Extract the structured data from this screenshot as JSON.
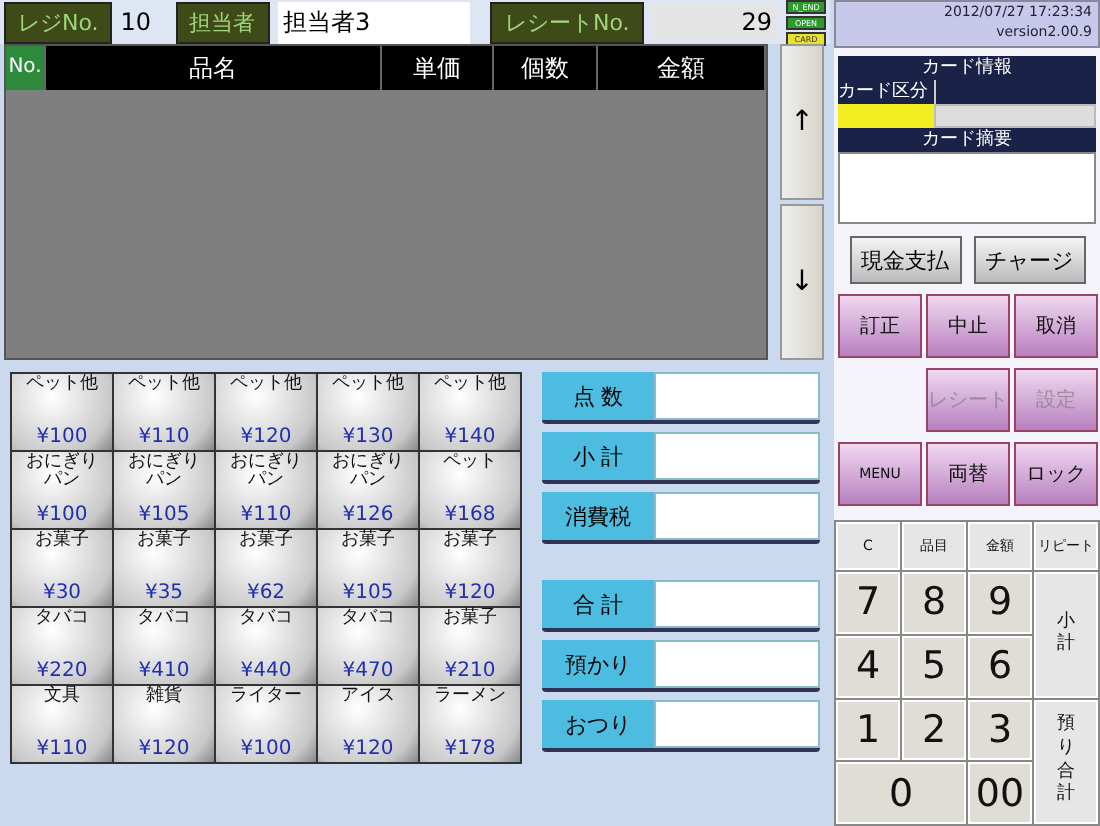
{
  "header": {
    "register_label": "レジNo.",
    "register_no": "10",
    "staff_label": "担当者",
    "staff_name": "担当者3",
    "receipt_label": "レシートNo.",
    "receipt_no": "29",
    "indicators": [
      {
        "label": "N_END",
        "color": "#2e9a2e"
      },
      {
        "label": "OPEN",
        "color": "#2e9a2e"
      },
      {
        "label": "CARD",
        "color": "#e8e030"
      }
    ]
  },
  "table": {
    "columns": [
      "No.",
      "品名",
      "単価",
      "個数",
      "金額"
    ]
  },
  "scroll_buttons": [
    "↑",
    "↓"
  ],
  "products": [
    {
      "name": "ペット他",
      "price": "¥100"
    },
    {
      "name": "ペット他",
      "price": "¥110"
    },
    {
      "name": "ペット他",
      "price": "¥120"
    },
    {
      "name": "ペット他",
      "price": "¥130"
    },
    {
      "name": "ペット他",
      "price": "¥140"
    },
    {
      "name": "おにぎりパン",
      "price": "¥100"
    },
    {
      "name": "おにぎりパン",
      "price": "¥105"
    },
    {
      "name": "おにぎりパン",
      "price": "¥110"
    },
    {
      "name": "おにぎりパン",
      "price": "¥126"
    },
    {
      "name": "ペット",
      "price": "¥168"
    },
    {
      "name": "お菓子",
      "price": "¥30"
    },
    {
      "name": "お菓子",
      "price": "¥35"
    },
    {
      "name": "お菓子",
      "price": "¥62"
    },
    {
      "name": "お菓子",
      "price": "¥105"
    },
    {
      "name": "お菓子",
      "price": "¥120"
    },
    {
      "name": "タバコ",
      "price": "¥220"
    },
    {
      "name": "タバコ",
      "price": "¥410"
    },
    {
      "name": "タバコ",
      "price": "¥440"
    },
    {
      "name": "タバコ",
      "price": "¥470"
    },
    {
      "name": "お菓子",
      "price": "¥210"
    },
    {
      "name": "文具",
      "price": "¥110"
    },
    {
      "name": "雑貨",
      "price": "¥120"
    },
    {
      "name": "ライター",
      "price": "¥100"
    },
    {
      "name": "アイス",
      "price": "¥120"
    },
    {
      "name": "ラーメン",
      "price": "¥178"
    }
  ],
  "totals_upper": [
    "点 数",
    "小 計",
    "消費税"
  ],
  "totals_lower": [
    "合 計",
    "預かり",
    "おつり"
  ],
  "info": {
    "datetime": "2012/07/27 17:23:34",
    "version": "version2.00.9"
  },
  "card": {
    "title": "カード情報",
    "type_label": "カード区分",
    "memo_label": "カード摘要"
  },
  "payment_buttons": [
    "現金支払",
    "チャージ"
  ],
  "function_buttons": [
    {
      "kind": "button",
      "label": "訂正",
      "disabled": false
    },
    {
      "kind": "button",
      "label": "中止",
      "disabled": false
    },
    {
      "kind": "button",
      "label": "取消",
      "disabled": false
    },
    {
      "kind": "blank"
    },
    {
      "kind": "button",
      "label": "レシート",
      "disabled": true
    },
    {
      "kind": "button",
      "label": "設定",
      "disabled": true
    },
    {
      "kind": "button",
      "label": "MENU",
      "disabled": false
    },
    {
      "kind": "button",
      "label": "両替",
      "disabled": false
    },
    {
      "kind": "button",
      "label": "ロック",
      "disabled": false
    }
  ],
  "keypad": [
    {
      "kind": "func",
      "label": "C"
    },
    {
      "kind": "func",
      "label": "品目"
    },
    {
      "kind": "func",
      "label": "金額"
    },
    {
      "kind": "func",
      "label": "リピート"
    },
    {
      "kind": "digit",
      "label": "7"
    },
    {
      "kind": "digit",
      "label": "8"
    },
    {
      "kind": "digit",
      "label": "9"
    },
    {
      "kind": "tall",
      "label": "小計"
    },
    {
      "kind": "digit",
      "label": "4"
    },
    {
      "kind": "digit",
      "label": "5"
    },
    {
      "kind": "digit",
      "label": "6"
    },
    {
      "kind": "digit",
      "label": "1"
    },
    {
      "kind": "digit",
      "label": "2"
    },
    {
      "kind": "digit",
      "label": "3"
    },
    {
      "kind": "wide",
      "label": "0"
    },
    {
      "kind": "digit",
      "label": "00"
    },
    {
      "kind": "tall",
      "label": "預り合計"
    }
  ]
}
